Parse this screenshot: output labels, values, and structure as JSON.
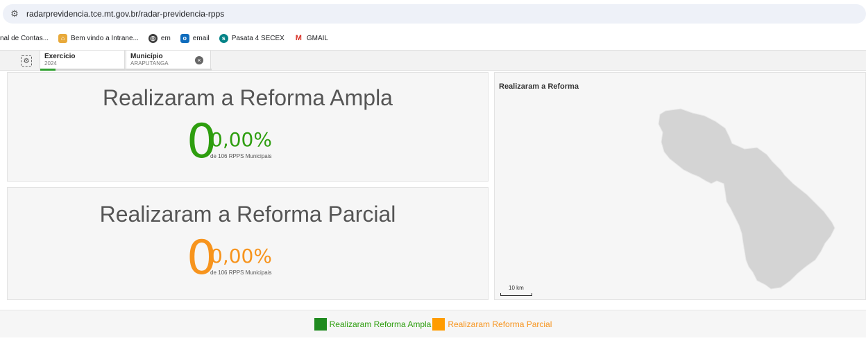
{
  "browser": {
    "url": "radarprevidencia.tce.mt.gov.br/radar-previdencia-rpps",
    "bookmarks": [
      {
        "label": "nal de Contas...",
        "icon": "none"
      },
      {
        "label": "Bem vindo a Intrane...",
        "icon": "intranet-icon"
      },
      {
        "label": "em",
        "icon": "globe-icon"
      },
      {
        "label": "email",
        "icon": "outlook-icon"
      },
      {
        "label": "Pasata 4 SECEX",
        "icon": "sharepoint-icon"
      },
      {
        "label": "GMAIL",
        "icon": "gmail-icon"
      }
    ]
  },
  "filters": {
    "exercicio": {
      "label": "Exercício",
      "value": "2024"
    },
    "municipio": {
      "label": "Município",
      "value": "ARAPUTANGA"
    }
  },
  "kpi_ampla": {
    "title": "Realizaram a Reforma Ampla",
    "count": "0",
    "percent": "0,00%",
    "subtitle": "de 106 RPPS Municipais",
    "color": "#2e9e0f"
  },
  "kpi_parcial": {
    "title": "Realizaram a Reforma Parcial",
    "count": "0",
    "percent": "0,00%",
    "subtitle": "de 106 RPPS Municipais",
    "color": "#f7941d"
  },
  "map": {
    "title": "Realizaram a Reforma",
    "scale_label": "10 km",
    "fill_color": "#d4d4d4"
  },
  "legend": [
    {
      "label": "Realizaram Reforma Ampla",
      "color": "#1f8a1f",
      "text_color": "#2e9e0f"
    },
    {
      "label": "Realizaram Reforma Parcial",
      "color": "#ff9c00",
      "text_color": "#f7941d"
    }
  ]
}
